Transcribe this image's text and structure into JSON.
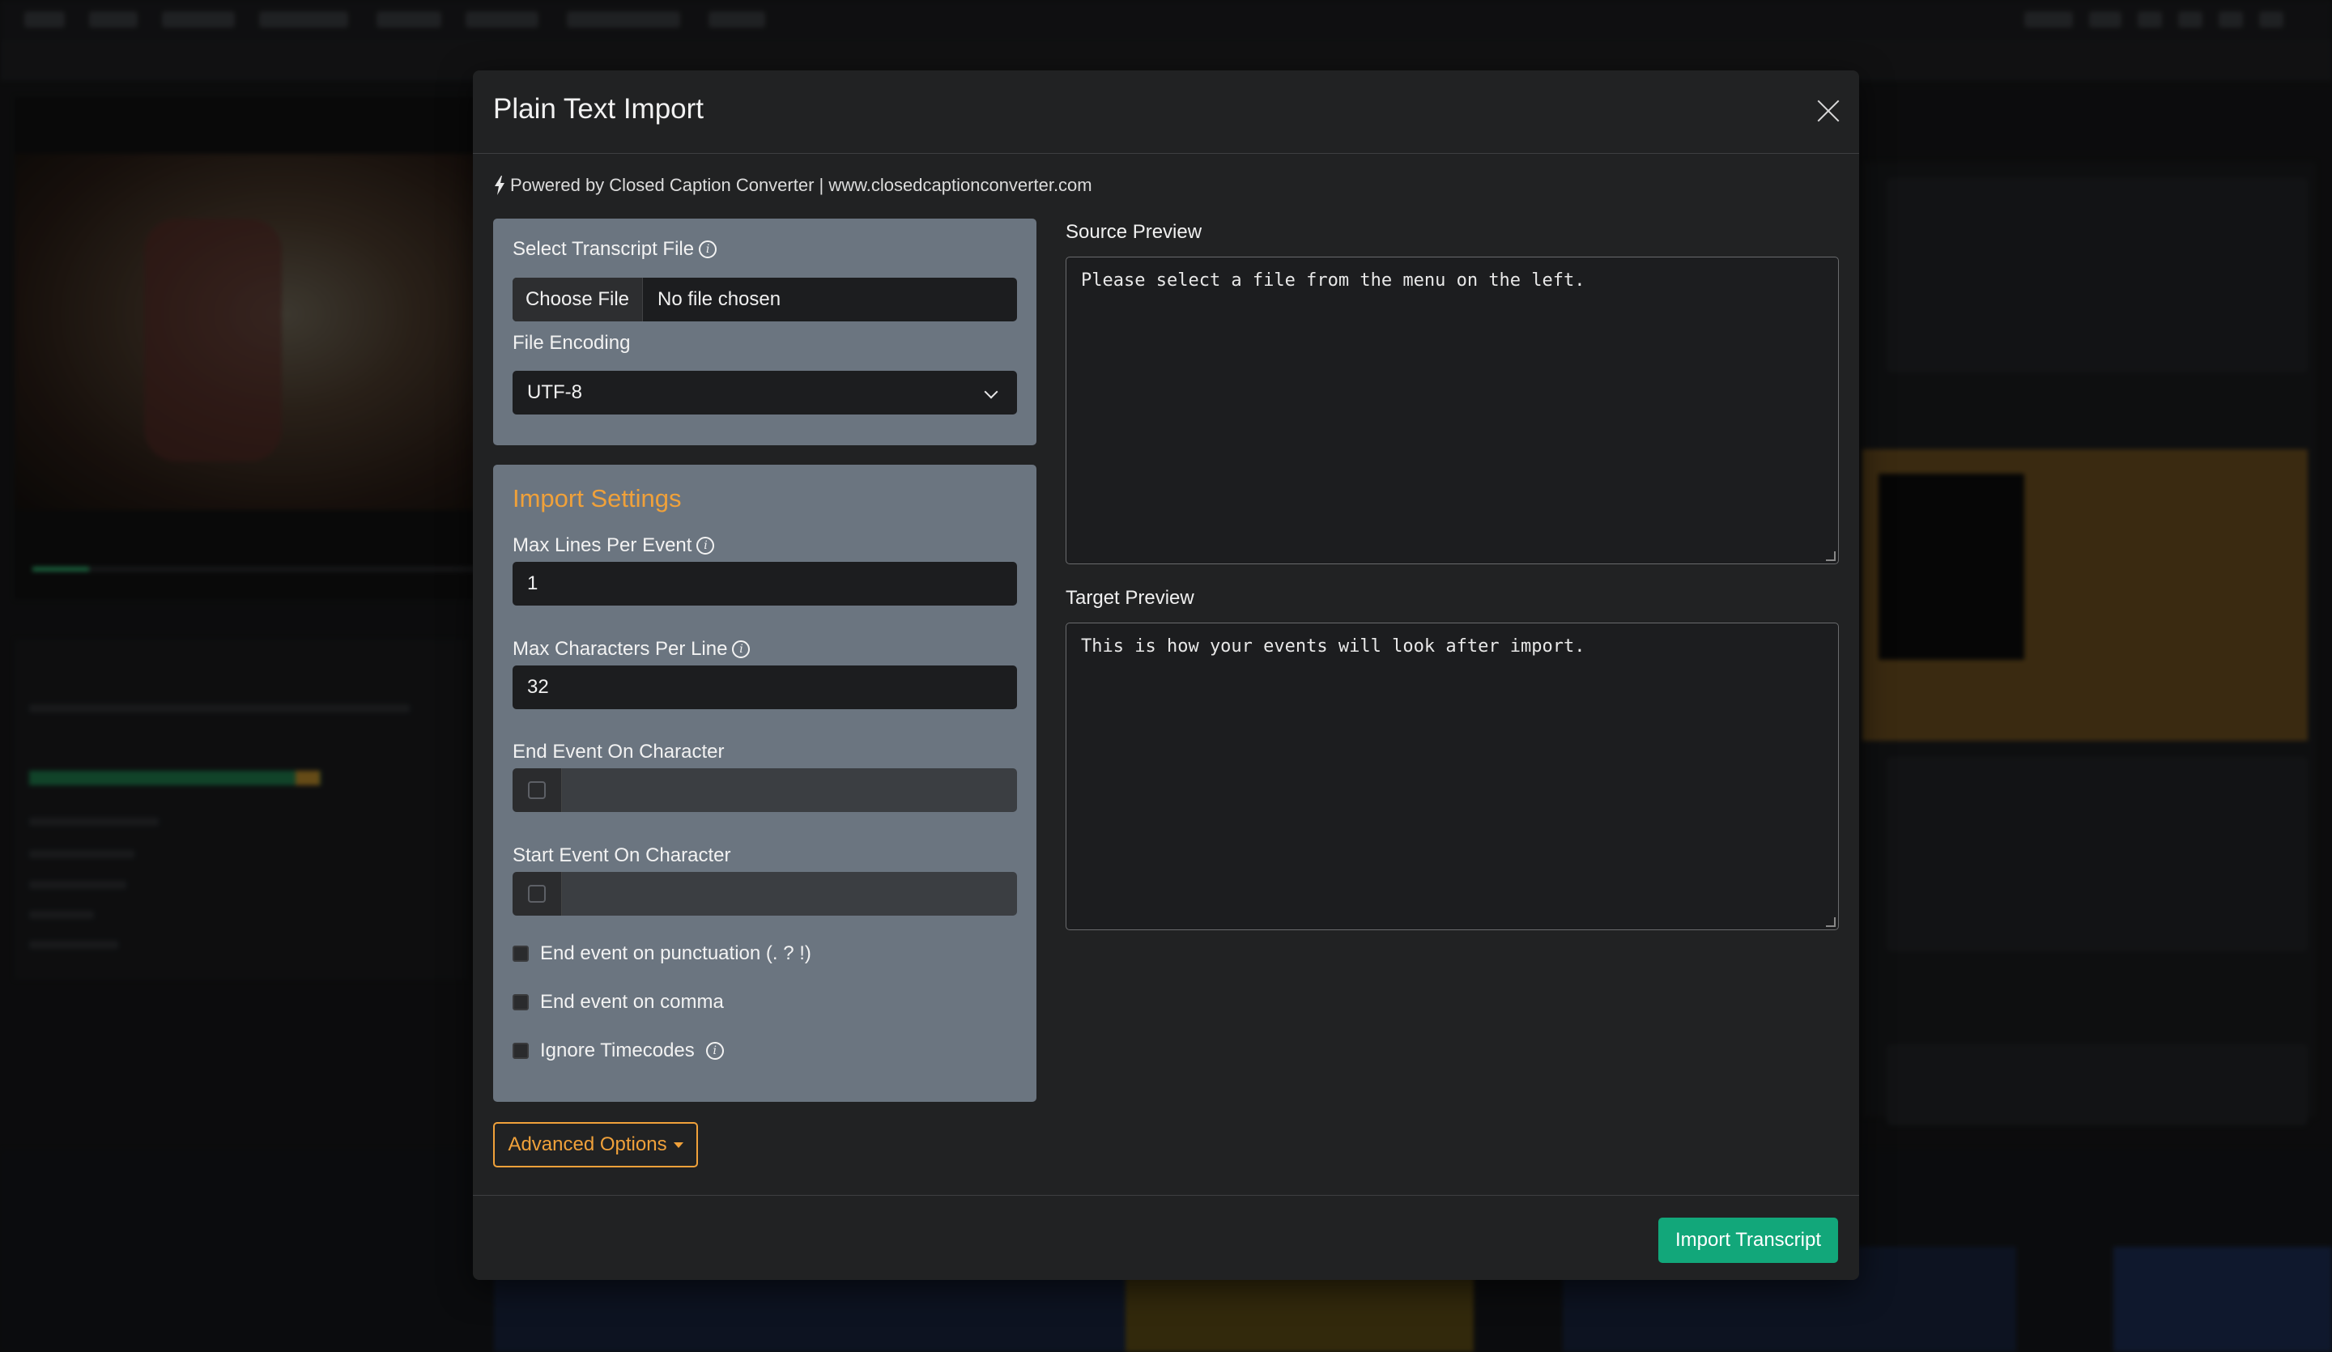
{
  "modal": {
    "title": "Plain Text Import",
    "powered_by": "Powered by Closed Caption Converter | www.closedcaptionconverter.com"
  },
  "file_section": {
    "select_label": "Select Transcript File",
    "choose_button": "Choose File",
    "file_status": "No file chosen",
    "encoding_label": "File Encoding",
    "encoding_value": "UTF-8"
  },
  "import_settings": {
    "title": "Import Settings",
    "max_lines_label": "Max Lines Per Event",
    "max_lines_value": "1",
    "max_chars_label": "Max Characters Per Line",
    "max_chars_value": "32",
    "end_event_char_label": "End Event On Character",
    "start_event_char_label": "Start Event On Character",
    "end_on_punctuation": "End event on punctuation (. ? !)",
    "end_on_comma": "End event on comma",
    "ignore_timecodes": "Ignore Timecodes"
  },
  "source_preview": {
    "label": "Source Preview",
    "text": "Please select a file from the menu on the left."
  },
  "target_preview": {
    "label": "Target Preview",
    "text": "This is how your events will look after import."
  },
  "buttons": {
    "advanced_options": "Advanced Options",
    "import_transcript": "Import Transcript"
  },
  "colors": {
    "accent_orange": "#f0a13a",
    "primary_green": "#12a77a",
    "card_bg": "#6b7580",
    "modal_bg": "#212223"
  },
  "icons": [
    "close-icon",
    "bolt-icon",
    "info-icon",
    "chevron-down-icon",
    "caret-down-icon"
  ]
}
